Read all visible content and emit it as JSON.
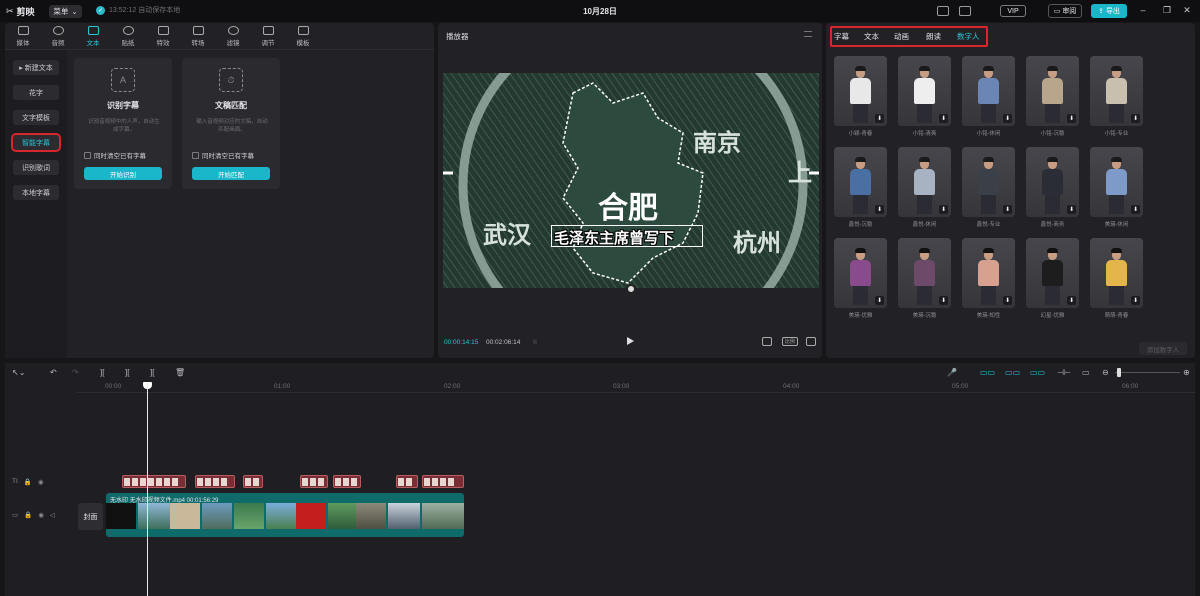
{
  "app": {
    "name": "剪映",
    "menu_label": "菜单",
    "autosave": "13:52:12 自动保存本地",
    "date": "10月28日",
    "vip": "VIP",
    "review": "审阅",
    "export": "导出"
  },
  "toolbar": [
    {
      "label": "媒体",
      "icon": "media-icon"
    },
    {
      "label": "音频",
      "icon": "audio-icon"
    },
    {
      "label": "文本",
      "icon": "text-icon",
      "active": true
    },
    {
      "label": "贴纸",
      "icon": "sticker-icon"
    },
    {
      "label": "特效",
      "icon": "effects-icon"
    },
    {
      "label": "转场",
      "icon": "transition-icon"
    },
    {
      "label": "滤镜",
      "icon": "filter-icon"
    },
    {
      "label": "调节",
      "icon": "adjust-icon"
    },
    {
      "label": "模板",
      "icon": "template-icon"
    }
  ],
  "sidebar": [
    "▸ 新建文本",
    "花字",
    "文字模板",
    "智能字幕",
    "识别歌词",
    "本地字幕"
  ],
  "cards": [
    {
      "title": "识别字幕",
      "desc": "识别音视频中的人声，自动生成字幕。",
      "checkbox": "同时清空已有字幕",
      "button": "开始识别"
    },
    {
      "title": "文稿匹配",
      "desc": "输入音视频对应的文稿，自动匹配画面。",
      "checkbox": "同时清空已有字幕",
      "button": "开始匹配"
    }
  ],
  "player": {
    "title": "播放器",
    "subtitle": "毛泽东主席曾写下",
    "map_center": "合肥",
    "map_labels": [
      "南京",
      "武汉",
      "杭州",
      "上"
    ],
    "time_current": "00:00:14:15",
    "time_total": "00:02:06:14",
    "ratio": "比例"
  },
  "right": {
    "tabs": [
      "字幕",
      "文本",
      "动画",
      "朗读",
      "数字人"
    ],
    "avatars": [
      "小颖-青春",
      "小铭-清爽",
      "小铭-休闲",
      "小铭-沉稳",
      "小铭-专业",
      "鑫悦-沉稳",
      "鑫悦-休闲",
      "鑫悦-专业",
      "鑫悦-商务",
      "美瑛-休闲",
      "美瑛-优雅",
      "美瑛-沉稳",
      "美瑛-知性",
      "幻星-优雅",
      "萌萌-青春"
    ],
    "add_button": "添加数字人"
  },
  "timeline": {
    "ticks": [
      "00:00",
      "01:00",
      "02:00",
      "03:00",
      "04:00",
      "05:00",
      "06:00"
    ],
    "video_label": "无水印  无水印视频文件.mp4  00:01:56:29",
    "cover": "封面"
  }
}
